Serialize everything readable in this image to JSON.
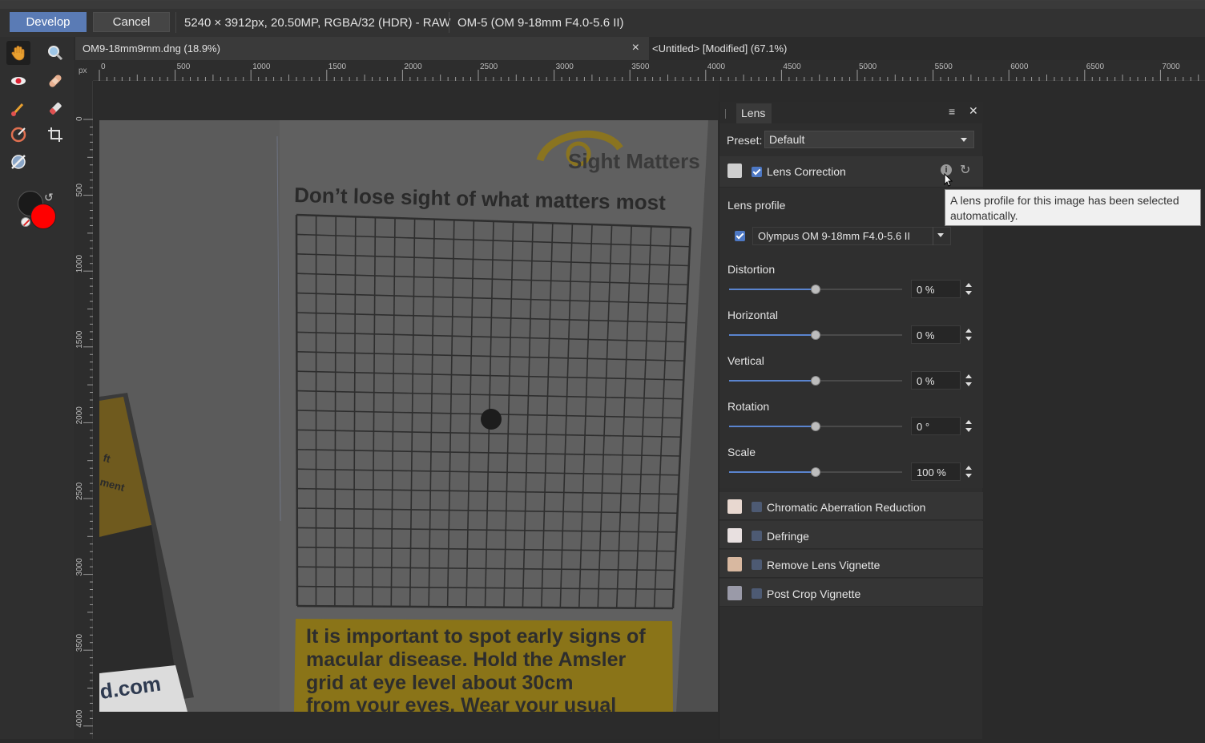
{
  "toolbar": {
    "develop_label": "Develop",
    "cancel_label": "Cancel",
    "image_info": "5240 × 3912px, 20.50MP, RGBA/32 (HDR) - RAW",
    "camera_info": "OM-5 (OM 9-18mm F4.0-5.6 II)"
  },
  "tabs": [
    {
      "label": "OM9-18mm9mm.dng (18.9%)",
      "close": "×"
    },
    {
      "label": "<Untitled> [Modified] (67.1%)"
    }
  ],
  "ruler": {
    "unit": "px",
    "h_labels": [
      "0",
      "500",
      "1000",
      "1500",
      "2000",
      "2500",
      "3000",
      "3500",
      "4000",
      "4500",
      "5000",
      "5500",
      "6000",
      "6500",
      "7000"
    ],
    "v_labels": [
      "0",
      "500",
      "1000",
      "1500",
      "2000",
      "2500",
      "3000",
      "3500",
      "4000"
    ]
  },
  "photo": {
    "brand": "Sight Matters",
    "headline": "Don’t lose sight of what matters most",
    "body_lines": [
      "It is important to spot early signs of",
      "macular disease. Hold the Amsler",
      "grid at eye level about 30cm",
      "from your eyes. Wear your usual"
    ],
    "side_text": [
      "ft",
      "ment"
    ],
    "url_fragment": "d.com"
  },
  "panel": {
    "tab_label": "Lens",
    "preset_label": "Preset:",
    "preset_value": "Default",
    "lens_correction_label": "Lens Correction",
    "lens_profile_label": "Lens profile",
    "lens_profile_value": "Olympus OM 9-18mm F4.0-5.6 II",
    "sliders": [
      {
        "label": "Distortion",
        "value": "0 %",
        "position": 0.5
      },
      {
        "label": "Horizontal",
        "value": "0 %",
        "position": 0.5
      },
      {
        "label": "Vertical",
        "value": "0 %",
        "position": 0.5
      },
      {
        "label": "Rotation",
        "value": "0 °",
        "position": 0.5
      },
      {
        "label": "Scale",
        "value": "100 %",
        "position": 0.5
      }
    ],
    "sections": [
      {
        "label": "Chromatic Aberration Reduction"
      },
      {
        "label": "Defringe"
      },
      {
        "label": "Remove Lens Vignette"
      },
      {
        "label": "Post Crop Vignette"
      }
    ]
  },
  "tooltip": {
    "text": "A lens profile for this image has been selected automatically."
  },
  "colors": {
    "accent": "#5a7bb5",
    "primary_color": "#1a1a1a",
    "secondary_color": "#ff0000"
  }
}
